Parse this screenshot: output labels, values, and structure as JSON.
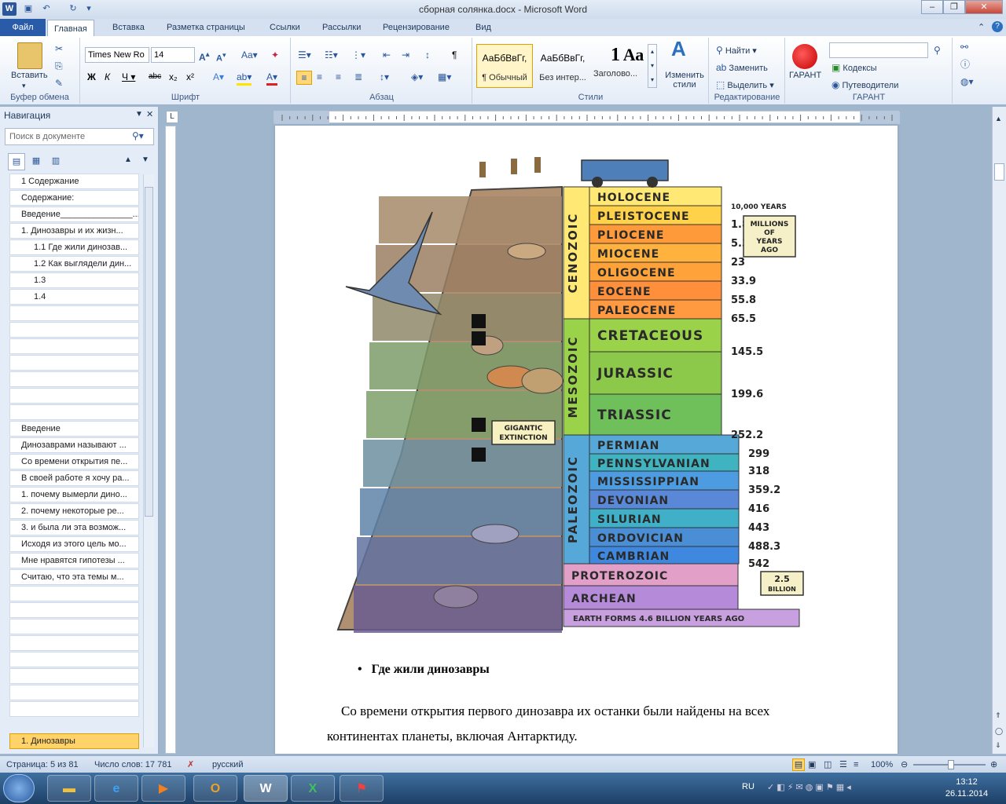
{
  "window": {
    "title": "сборная солянка.docx - Microsoft Word"
  },
  "tabs": [
    "Файл",
    "Главная",
    "Вставка",
    "Разметка страницы",
    "Ссылки",
    "Рассылки",
    "Рецензирование",
    "Вид"
  ],
  "ribbon": {
    "clipboard": {
      "paste": "Вставить",
      "label": "Буфер обмена"
    },
    "font": {
      "name": "Times New Ro",
      "size": "14",
      "label": "Шрифт"
    },
    "paragraph": {
      "label": "Абзац"
    },
    "styles": {
      "label": "Стили",
      "items": [
        {
          "preview": "АаБбВвГг,",
          "name": "¶ Обычный"
        },
        {
          "preview": "АаБбВвГг,",
          "name": "Без интер..."
        },
        {
          "preview": "1",
          "name": "Заголово..."
        },
        {
          "preview": "Аа",
          "name": ""
        }
      ],
      "change": "Изменить стили"
    },
    "editing": {
      "label": "Редактирование",
      "find": "Найти",
      "replace": "Заменить",
      "select": "Выделить"
    },
    "garant": {
      "label": "ГАРАНТ",
      "button": "ГАРАНТ",
      "codes": "Кодексы",
      "guides": "Путеводители"
    }
  },
  "nav": {
    "title": "Навигация",
    "search_placeholder": "Поиск в документе",
    "items": [
      "1 Содержание",
      "Содержание:",
      "Введение_______________...",
      "1. Динозавры и их жизн...",
      "1.1 Где жили динозав...",
      "1.2 Как выглядели дин...",
      "1.3",
      "1.4",
      "",
      "",
      "",
      "",
      "",
      "",
      "",
      "Введение",
      "Динозаврами называют ...",
      "Со времени открытия пе...",
      "В своей работе я хочу ра...",
      "1. почему вымерли дино...",
      "2. почему некоторые ре...",
      "3. и была ли эта возмож...",
      "Исходя из этого цель мо...",
      "Мне нравятся гипотезы ...",
      "Считаю, что  эта темы м...",
      "",
      "",
      "",
      "",
      "",
      "",
      "",
      "",
      "1. Динозавры"
    ]
  },
  "illustration": {
    "eras": [
      "CENOZOIC",
      "MESOZOIC",
      "PALEOZOIC"
    ],
    "periods": [
      "HOLOCENE",
      "PLEISTOCENE",
      "PLIOCENE",
      "MIOCENE",
      "OLIGOCENE",
      "EOCENE",
      "PALEOCENE",
      "CRETACEOUS",
      "JURASSIC",
      "TRIASSIC",
      "PERMIAN",
      "PENNSYLVANIAN",
      "MISSISSIPPIAN",
      "DEVONIAN",
      "SILURIAN",
      "ORDOVICIAN",
      "CAMBRIAN",
      "PROTEROZOIC",
      "ARCHEAN"
    ],
    "ages": [
      "10,000 YEARS",
      "1.8",
      "5.3",
      "23",
      "33.9",
      "55.8",
      "65.5",
      "145.5",
      "199.6",
      "252.2",
      "299",
      "318",
      "359.2",
      "416",
      "443",
      "488.3",
      "542"
    ],
    "unit_note": "MILLIONS OF YEARS AGO",
    "billion": "2.5 BILLION",
    "earth": "EARTH FORMS 4.6 BILLION YEARS AGO",
    "extinction": "GIGANTIC EXTINCTION"
  },
  "document": {
    "bullet": "Где жили динозавры",
    "line1": "Со времени открытия первого динозавра их останки были найдены на всех",
    "line2": "континентах планеты, включая Антарктиду."
  },
  "status": {
    "page": "Страница: 5 из 81",
    "words": "Число слов: 17 781",
    "lang": "русский",
    "zoom": "100%"
  },
  "taskbar": {
    "lang": "RU",
    "time": "13:12",
    "date": "26.11.2014"
  }
}
